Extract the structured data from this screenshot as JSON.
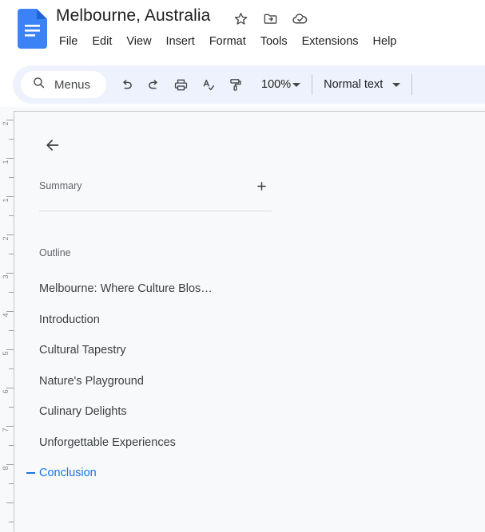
{
  "header": {
    "doc_icon": "google-docs-icon",
    "title": "Melbourne, Australia",
    "title_icons": [
      {
        "name": "star-icon",
        "label": "Star"
      },
      {
        "name": "move-to-folder-icon",
        "label": "Move"
      },
      {
        "name": "cloud-saved-icon",
        "label": "Saved to Drive"
      }
    ],
    "menus": [
      "File",
      "Edit",
      "View",
      "Insert",
      "Format",
      "Tools",
      "Extensions",
      "Help"
    ]
  },
  "toolbar": {
    "search": {
      "icon": "search-icon",
      "value": "Menus",
      "placeholder": "Menus"
    },
    "buttons": [
      {
        "name": "undo-button",
        "icon": "undo-icon",
        "label": "Undo"
      },
      {
        "name": "redo-button",
        "icon": "redo-icon",
        "label": "Redo"
      },
      {
        "name": "print-button",
        "icon": "print-icon",
        "label": "Print"
      },
      {
        "name": "spelling-button",
        "icon": "spellcheck-icon",
        "label": "Spelling and grammar check"
      },
      {
        "name": "paint-format-button",
        "icon": "paint-roller-icon",
        "label": "Paint format"
      }
    ],
    "zoom": {
      "value": "100%",
      "caret": "chevron-down-icon"
    },
    "text_style": {
      "value": "Normal text",
      "caret": "chevron-down-icon"
    }
  },
  "panel": {
    "back_icon": "arrow-left-icon",
    "summary_label": "Summary",
    "add_icon": "plus-icon",
    "outline_label": "Outline",
    "items": [
      {
        "text": "Melbourne: Where Culture Blos…",
        "active": false
      },
      {
        "text": "Introduction",
        "active": false
      },
      {
        "text": "Cultural Tapestry",
        "active": false
      },
      {
        "text": "Nature's Playground",
        "active": false
      },
      {
        "text": "Culinary Delights",
        "active": false
      },
      {
        "text": "Unforgettable Experiences",
        "active": false
      },
      {
        "text": "Conclusion",
        "active": true
      }
    ]
  },
  "ruler": {
    "numbers": [
      "2",
      "1",
      "1",
      "2",
      "3",
      "4",
      "5",
      "6",
      "7",
      "8"
    ]
  },
  "colors": {
    "accent": "#1a73e8",
    "toolbar_bg": "#edf2fc",
    "workspace_bg": "#f8f9fa",
    "text": "#1f1f1f",
    "muted_text": "#5f6368"
  }
}
